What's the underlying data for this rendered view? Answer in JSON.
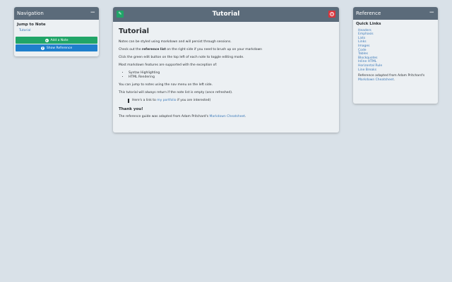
{
  "nav": {
    "title": "Navigation",
    "collapse": "−",
    "jump_heading": "Jump to Note",
    "items": [
      "Tutorial"
    ],
    "add_button": "Add a Note",
    "add_icon": "+",
    "show_button": "Show Reference",
    "show_icon": "?"
  },
  "note": {
    "title": "Tutorial",
    "edit_icon": "pencil-icon",
    "heading": "Tutorial",
    "p1": "Notes can be styled using markdown and will persist through sessions.",
    "p2_pre": "Check out the ",
    "p2_bold": "reference list",
    "p2_post": " on the right side if you need to brush up on your markdown",
    "p3": "Click the green edit button on the top left of each note to toggle editing mode.",
    "p4": "Most markdown features are supported with the exception of:",
    "exceptions": [
      "Syntax Highlighting",
      "HTML Rendering"
    ],
    "p5": "You can jump to notes using the nav menu on the left side.",
    "p6": "This tutorial will always return if the note list is empty (once refreshed).",
    "quote_pre": "Here's a link to ",
    "quote_link": "my portfolio",
    "quote_post": " if you are interested)",
    "thanks": "Thank you!",
    "footer_pre": "The reference guide was adapted from Adam Pritchard's ",
    "footer_link": "Markdown Cheatsheet",
    "footer_post": "."
  },
  "ref": {
    "title": "Reference",
    "collapse": "−",
    "quick_links_heading": "Quick Links",
    "links": [
      "Headers",
      "Emphasis",
      "Lists",
      "Links",
      "Images",
      "Code",
      "Tables",
      "Blockquotes",
      "Inline HTML",
      "Horizontal Rule",
      "Line Breaks"
    ],
    "adapted_pre": "Reference adapted from Adam Pritchard's ",
    "adapted_link": "Markdown Cheatsheet",
    "adapted_post": "."
  },
  "colors": {
    "header": "#5b6b7a",
    "add_green": "#21a568",
    "show_blue": "#1f7fcc",
    "close_red": "#d9343b",
    "link": "#3a78b8"
  }
}
